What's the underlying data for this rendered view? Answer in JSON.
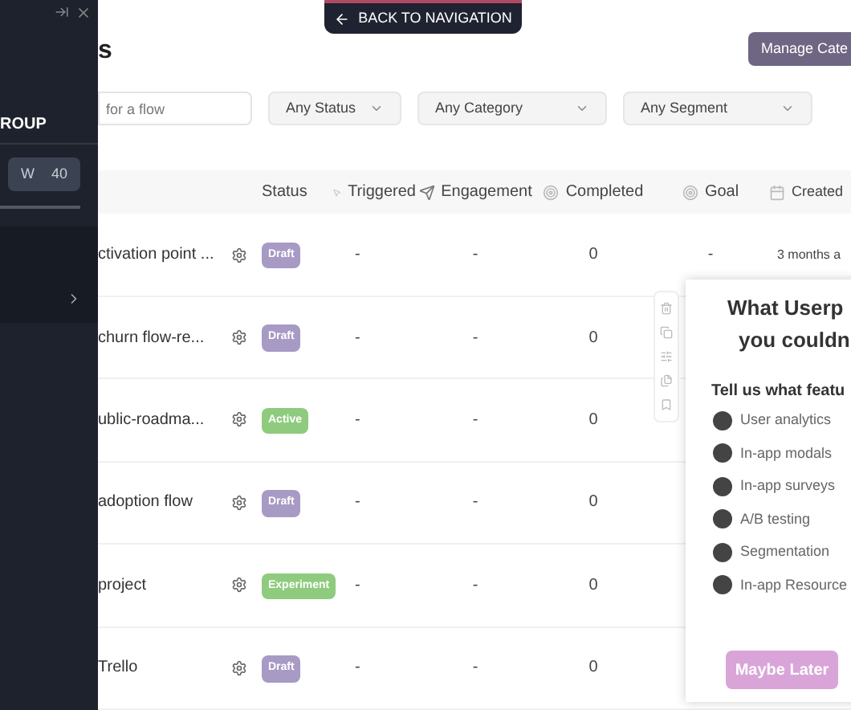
{
  "sidebar": {
    "section_title": "ROUP",
    "field": {
      "label": "W",
      "value": "40"
    }
  },
  "back_button": {
    "label": "BACK TO NAVIGATION"
  },
  "page": {
    "title": "s",
    "manage_button": "Manage Cate"
  },
  "search": {
    "placeholder": "for a flow"
  },
  "filters": [
    "Any Status",
    "Any Category",
    "Any Segment"
  ],
  "table": {
    "columns": [
      "Status",
      "Triggered",
      "Engagement",
      "Completed",
      "Goal",
      "Created"
    ],
    "rows": [
      {
        "name": "ctivation point ...",
        "status": "Draft",
        "kind": "draft",
        "triggered": "-",
        "engagement": "-",
        "completed": "0",
        "goal": "-",
        "created": "3 months a"
      },
      {
        "name": "churn flow-re...",
        "status": "Draft",
        "kind": "draft",
        "triggered": "-",
        "engagement": "-",
        "completed": "0"
      },
      {
        "name": "ublic-roadma...",
        "status": "Active",
        "kind": "active",
        "triggered": "-",
        "engagement": "-",
        "completed": "0"
      },
      {
        "name": "adoption flow",
        "status": "Draft",
        "kind": "draft",
        "triggered": "-",
        "engagement": "-",
        "completed": "0"
      },
      {
        "name": "project",
        "status": "Experiment",
        "kind": "active",
        "triggered": "-",
        "engagement": "-",
        "completed": "0"
      },
      {
        "name": "Trello",
        "status": "Draft",
        "kind": "draft",
        "triggered": "-",
        "engagement": "-",
        "completed": "0"
      }
    ]
  },
  "survey": {
    "title_lines": [
      "What Userp",
      "you couldn"
    ],
    "question": "Tell us what featu",
    "options": [
      {
        "label": "User analytics",
        "selected": false
      },
      {
        "label": "In-app modals",
        "selected": false
      },
      {
        "label": "In-app surveys",
        "selected": false
      },
      {
        "label": "A/B testing",
        "selected": false
      },
      {
        "label": "Segmentation",
        "selected": false
      },
      {
        "label": "In-app Resource",
        "selected": false
      }
    ],
    "button": "Maybe Later"
  }
}
